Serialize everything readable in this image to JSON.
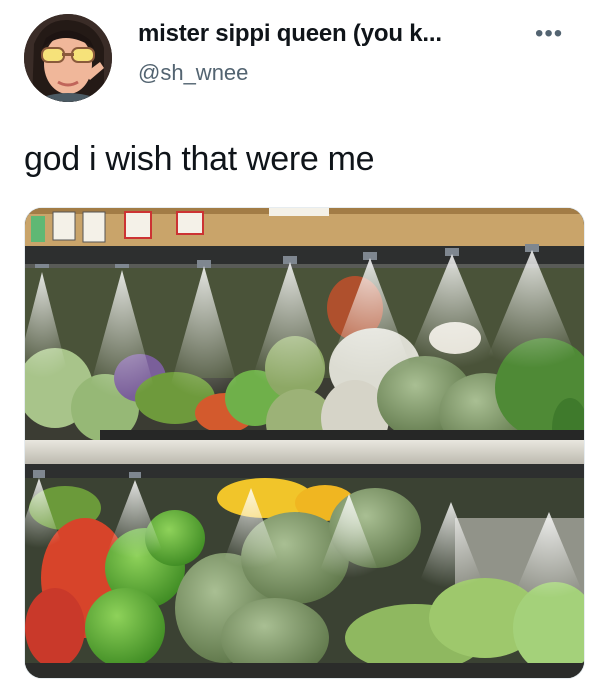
{
  "tweet": {
    "display_name": "mister sippi queen (you k...",
    "handle": "@sh_wnee",
    "more_icon": "more-horizontal-icon",
    "text": "god i wish that were me",
    "avatar_icon": "avatar-photo",
    "media": {
      "icon": "photo-produce-mist"
    }
  }
}
